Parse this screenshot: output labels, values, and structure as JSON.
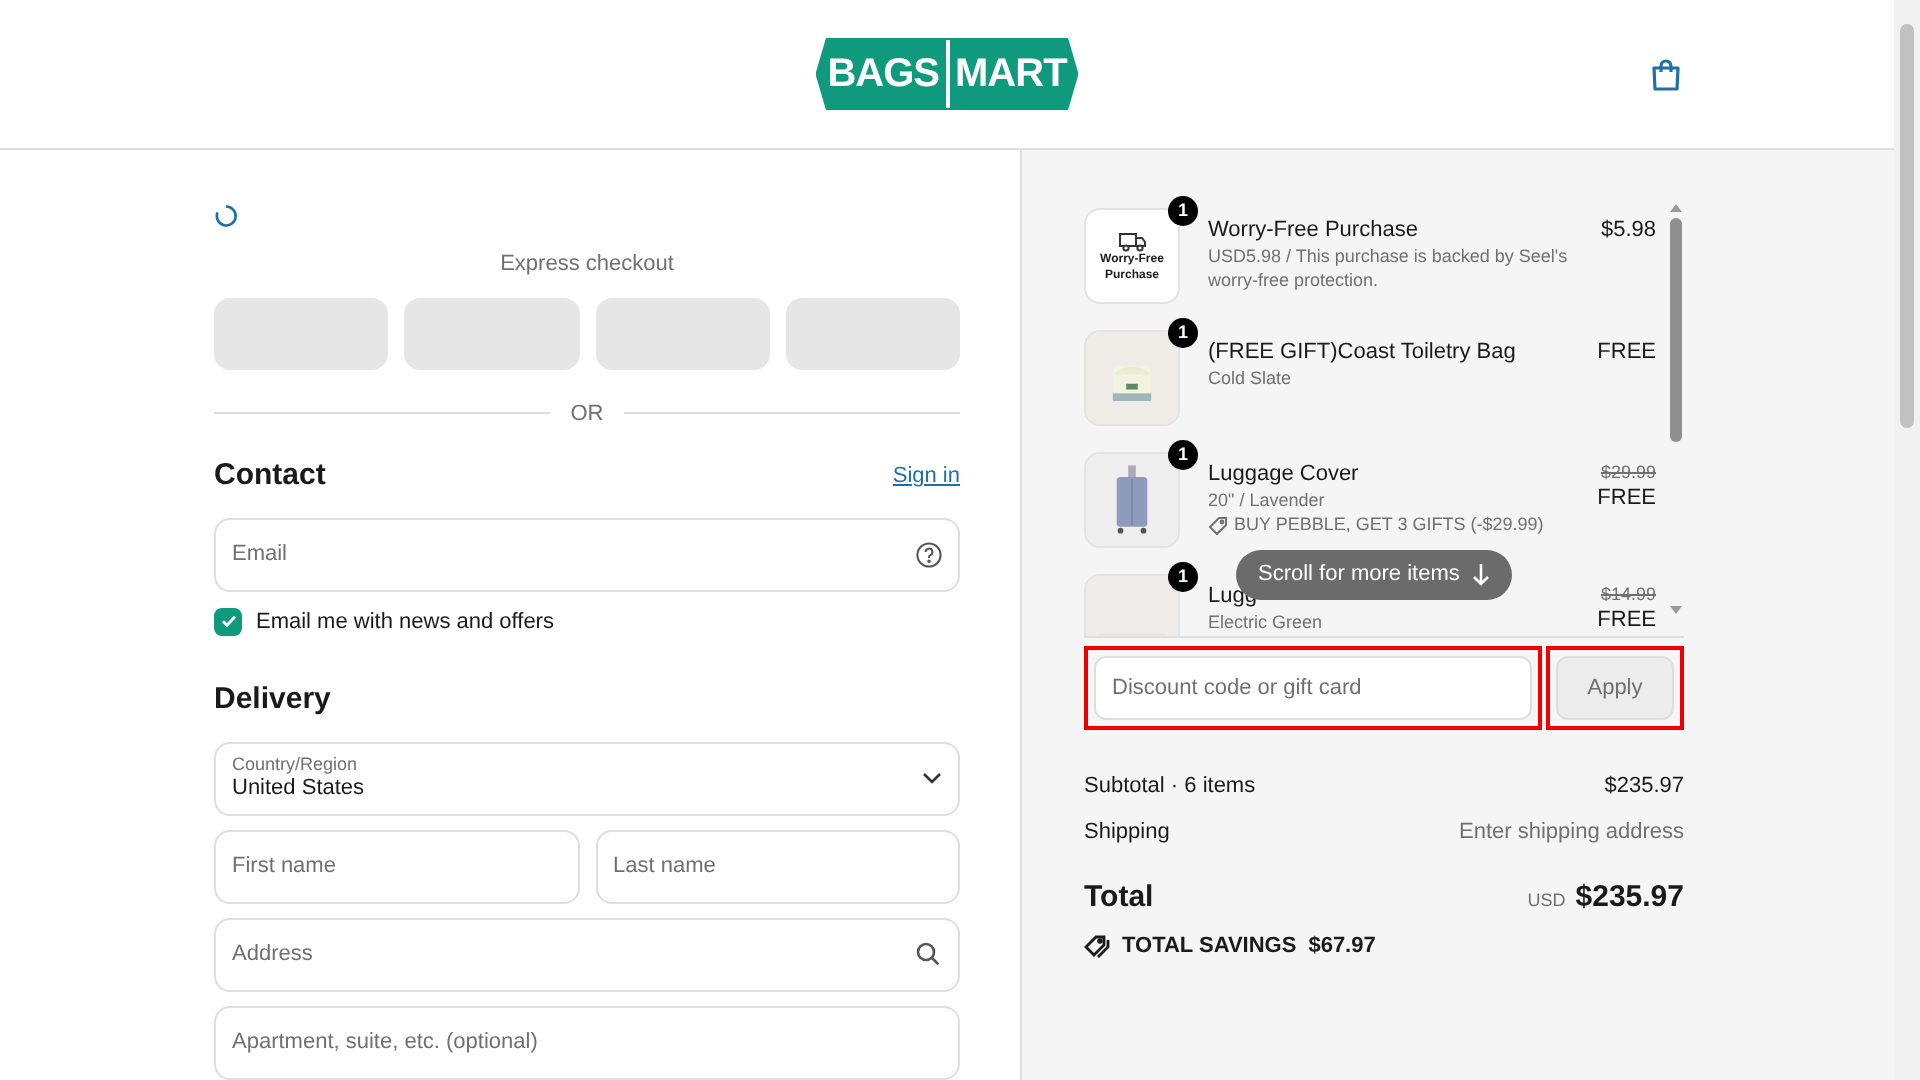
{
  "header": {
    "logo": [
      "BAGS",
      "MART"
    ]
  },
  "checkout": {
    "express_label": "Express checkout",
    "divider": "OR",
    "contact": {
      "title": "Contact",
      "sign_in": "Sign in",
      "email_placeholder": "Email",
      "newsletter": {
        "label": "Email me with news and offers",
        "checked": true
      }
    },
    "delivery": {
      "title": "Delivery",
      "country_label": "Country/Region",
      "country": "United States",
      "first_name_placeholder": "First name",
      "last_name_placeholder": "Last name",
      "address_placeholder": "Address",
      "apartment_placeholder": "Apartment, suite, etc. (optional)"
    }
  },
  "summary": {
    "items": [
      {
        "kind": "badge",
        "thumbnail_text": "Worry-Free Purchase",
        "qty": "1",
        "title": "Worry-Free Purchase",
        "details": [
          "USD5.98 / This purchase is backed by Seel's worry-free protection."
        ],
        "price": "$5.98"
      },
      {
        "kind": "toiletry",
        "qty": "1",
        "title": "(FREE GIFT)Coast Toiletry Bag",
        "details": [
          "Cold Slate"
        ],
        "price": "FREE"
      },
      {
        "kind": "suitcase",
        "qty": "1",
        "title": "Luggage Cover",
        "details": [
          "20\" / Lavender"
        ],
        "discount": "BUY PEBBLE, GET 3 GIFTS (-$29.99)",
        "old_price": "$29.99",
        "price": "FREE"
      },
      {
        "kind": "plain",
        "qty": "1",
        "title": "Lugg",
        "details": [
          "Electric Green"
        ],
        "old_price": "$14.99",
        "price": "FREE"
      }
    ],
    "scroll_hint": "Scroll for more items",
    "discount_placeholder": "Discount code or gift card",
    "apply": "Apply",
    "subtotal_label": "Subtotal · 6 items",
    "subtotal": "$235.97",
    "shipping_label": "Shipping",
    "shipping": "Enter shipping address",
    "total_label": "Total",
    "currency": "USD",
    "total": "$235.97",
    "savings_label": "TOTAL SAVINGS",
    "savings": "$67.97"
  }
}
